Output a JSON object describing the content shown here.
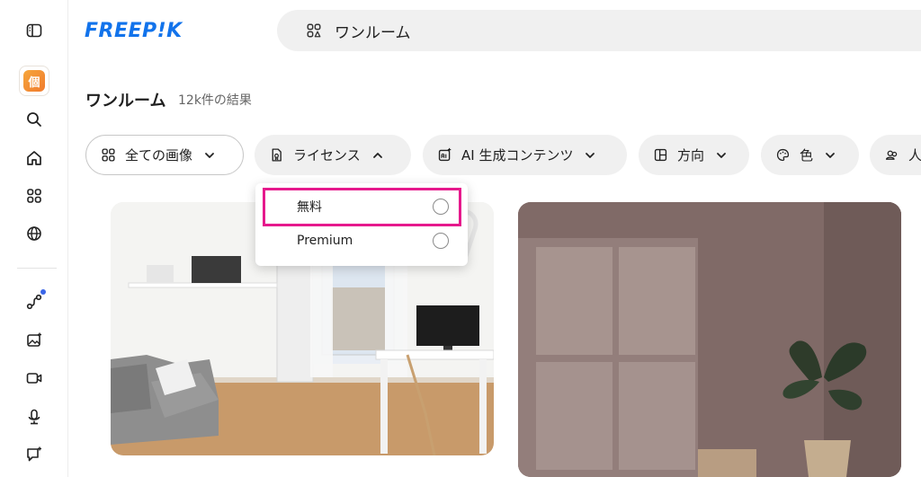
{
  "brand": {
    "logo_text": "FREEP!K",
    "logo_color": "#1273eb"
  },
  "search": {
    "query": "ワンルーム"
  },
  "results": {
    "title": "ワンルーム",
    "count": "12k件の結果"
  },
  "filters": [
    {
      "label": "全ての画像",
      "icon": "grid-icon",
      "state": "selected"
    },
    {
      "label": "ライセンス",
      "icon": "license-icon",
      "state": "open"
    },
    {
      "label": "AI 生成コンテンツ",
      "icon": "ai-image-icon",
      "state": "closed"
    },
    {
      "label": "方向",
      "icon": "layout-icon",
      "state": "closed"
    },
    {
      "label": "色",
      "icon": "palette-icon",
      "state": "closed"
    },
    {
      "label": "人",
      "icon": "people-icon",
      "state": "closed"
    }
  ],
  "license_dropdown": {
    "options": [
      {
        "label": "無料",
        "selected": false
      },
      {
        "label": "Premium",
        "selected": false
      }
    ],
    "highlight_color": "#e6198c"
  },
  "sidebar": {
    "items": [
      {
        "icon": "sidebar-toggle-icon"
      },
      {
        "icon": "avatar",
        "text": "個"
      },
      {
        "icon": "search-icon"
      },
      {
        "icon": "home-icon"
      },
      {
        "icon": "apps-grid-icon"
      },
      {
        "icon": "globe-icon"
      },
      {
        "icon": "workflow-icon",
        "badge": true
      },
      {
        "icon": "image-generator-icon"
      },
      {
        "icon": "video-icon"
      },
      {
        "icon": "audio-icon"
      },
      {
        "icon": "chat-icon"
      }
    ]
  },
  "images": [
    {
      "name": "white-one-room-interior-photo"
    },
    {
      "name": "window-shadow-wall-photo"
    }
  ]
}
